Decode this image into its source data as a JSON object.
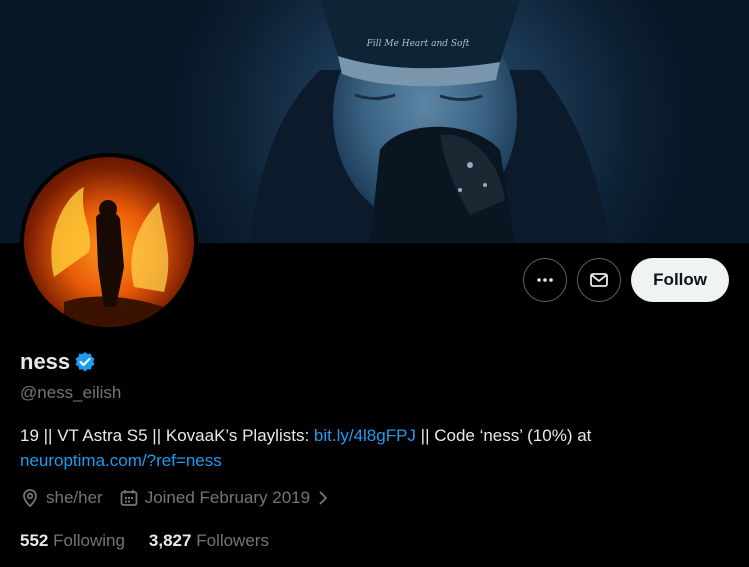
{
  "banner": {
    "cap_text": "Fill Me Heart and Soft"
  },
  "profile": {
    "display_name": "ness",
    "handle": "@ness_eilish",
    "bio_text_1": "19 || VT Astra S5 || KovaaK’s Playlists: ",
    "bio_link_1": "bit.ly/4l8gFPJ",
    "bio_text_2": " || Code ‘ness’ (10%) at",
    "bio_link_2": "neuroptima.com/?ref=ness",
    "pronouns": "she/her",
    "joined": "Joined February 2019",
    "following_count": "552",
    "following_label": "Following",
    "followers_count": "3,827",
    "followers_label": "Followers"
  },
  "actions": {
    "follow_label": "Follow"
  },
  "colors": {
    "accent": "#1d9bf0",
    "verified": "#1d9bf0",
    "muted": "#71767b",
    "background": "#000000"
  },
  "icons": [
    "more-icon",
    "message-icon",
    "verified-badge-icon",
    "location-icon",
    "calendar-icon",
    "chevron-right-icon"
  ]
}
